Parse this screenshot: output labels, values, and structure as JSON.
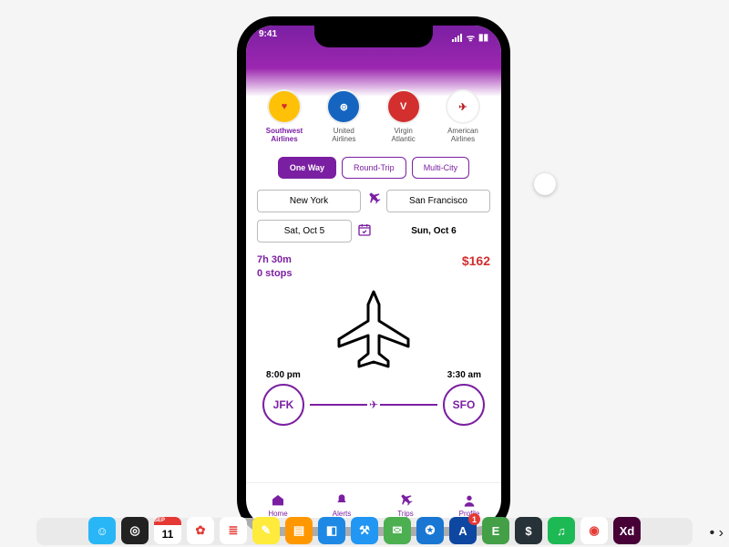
{
  "status": {
    "time": "9:41"
  },
  "airlines": [
    {
      "name": "Southwest Airlines",
      "active": true,
      "bg": "#FFC107",
      "fg": "#D32F2F",
      "mark": "♥"
    },
    {
      "name": "United Airlines",
      "active": false,
      "bg": "#1565C0",
      "fg": "#fff",
      "mark": "⊛"
    },
    {
      "name": "Virgin Atlantic",
      "active": false,
      "bg": "#D32F2F",
      "fg": "#fff",
      "mark": "V"
    },
    {
      "name": "American Airlines",
      "active": false,
      "bg": "#fff",
      "fg": "#B71C1C",
      "mark": "✈"
    }
  ],
  "trip_types": [
    {
      "label": "One Way",
      "active": true
    },
    {
      "label": "Round-Trip",
      "active": false
    },
    {
      "label": "Multi-City",
      "active": false
    }
  ],
  "route": {
    "from": "New York",
    "to": "San Francisco"
  },
  "dates": {
    "depart": "Sat, Oct 5",
    "return": "Sun, Oct 6"
  },
  "summary": {
    "duration": "7h 30m",
    "stops": "0 stops",
    "price": "$162"
  },
  "times": {
    "dep": "8:00 pm",
    "arr": "3:30 am"
  },
  "codes": {
    "from": "JFK",
    "to": "SFO"
  },
  "nav": [
    {
      "label": "Home"
    },
    {
      "label": "Alerts"
    },
    {
      "label": "Trips"
    },
    {
      "label": "Profile"
    }
  ],
  "dock": [
    {
      "name": "finder",
      "bg": "#29B6F6",
      "glyph": "☺"
    },
    {
      "name": "siri",
      "bg": "#222",
      "glyph": "◎"
    },
    {
      "name": "calendar",
      "bg": "#fff",
      "glyph": "",
      "cal_top": "SEP",
      "cal_day": "11"
    },
    {
      "name": "photos",
      "bg": "#fff",
      "glyph": "✿"
    },
    {
      "name": "reminders",
      "bg": "#fff",
      "glyph": "≣"
    },
    {
      "name": "notes",
      "bg": "#FFEB3B",
      "glyph": "✎"
    },
    {
      "name": "books",
      "bg": "#FF9800",
      "glyph": "▤"
    },
    {
      "name": "preview",
      "bg": "#1E88E5",
      "glyph": "◧"
    },
    {
      "name": "xcode",
      "bg": "#2196F3",
      "glyph": "⚒"
    },
    {
      "name": "messages",
      "bg": "#4CAF50",
      "glyph": "✉"
    },
    {
      "name": "safari",
      "bg": "#1976D2",
      "glyph": "✪"
    },
    {
      "name": "app-store",
      "bg": "#0D47A1",
      "glyph": "A",
      "badge": "1"
    },
    {
      "name": "evernote",
      "bg": "#43A047",
      "glyph": "E"
    },
    {
      "name": "iterm",
      "bg": "#263238",
      "glyph": "$"
    },
    {
      "name": "spotify",
      "bg": "#1DB954",
      "glyph": "♫"
    },
    {
      "name": "chrome",
      "bg": "#fff",
      "glyph": "◉"
    },
    {
      "name": "adobe-xd",
      "bg": "#470137",
      "glyph": "Xd"
    }
  ]
}
